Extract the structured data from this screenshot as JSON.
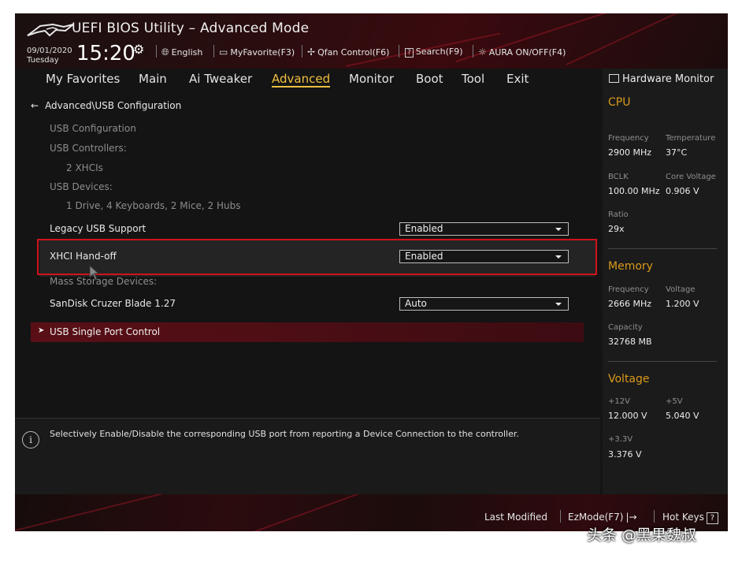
{
  "header": {
    "title": "UEFI BIOS Utility – Advanced Mode",
    "date": "09/01/2020",
    "day": "Tuesday",
    "time": "15:20",
    "tools": [
      {
        "label": "English",
        "icon": "globe-icon"
      },
      {
        "label": "MyFavorite(F3)",
        "icon": "favorites-icon"
      },
      {
        "label": "Qfan Control(F6)",
        "icon": "fan-icon"
      },
      {
        "label": "Search(F9)",
        "icon": "search-help-icon"
      },
      {
        "label": "AURA ON/OFF(F4)",
        "icon": "aura-icon"
      }
    ]
  },
  "nav": {
    "tabs": [
      "My Favorites",
      "Main",
      "Ai Tweaker",
      "Advanced",
      "Monitor",
      "Boot",
      "Tool",
      "Exit"
    ],
    "active": "Advanced"
  },
  "main": {
    "breadcrumb": "Advanced\\USB Configuration",
    "info": {
      "usb_config": "USB Configuration",
      "usb_controllers": "USB Controllers:",
      "controllers_value": "2 XHCIs",
      "usb_devices": "USB Devices:",
      "devices_value": "1 Drive, 4 Keyboards, 2 Mice, 2 Hubs",
      "mass_storage": "Mass Storage Devices:"
    },
    "settings": [
      {
        "label": "Legacy USB Support",
        "value": "Enabled"
      },
      {
        "label": "XHCI Hand-off",
        "value": "Enabled"
      },
      {
        "label": "SanDisk Cruzer Blade 1.27",
        "value": "Auto"
      }
    ],
    "submenu": "USB Single Port Control",
    "help": "Selectively Enable/Disable the corresponding USB port from reporting a Device Connection to the controller."
  },
  "hardware_monitor": {
    "title": "Hardware Monitor",
    "cpu": {
      "heading": "CPU",
      "frequency_label": "Frequency",
      "frequency": "2900 MHz",
      "temperature_label": "Temperature",
      "temperature": "37°C",
      "bclk_label": "BCLK",
      "bclk": "100.00 MHz",
      "core_voltage_label": "Core Voltage",
      "core_voltage": "0.906 V",
      "ratio_label": "Ratio",
      "ratio": "29x"
    },
    "memory": {
      "heading": "Memory",
      "frequency_label": "Frequency",
      "frequency": "2666 MHz",
      "voltage_label": "Voltage",
      "voltage": "1.200 V",
      "capacity_label": "Capacity",
      "capacity": "32768 MB"
    },
    "voltage": {
      "heading": "Voltage",
      "v12_label": "+12V",
      "v12": "12.000 V",
      "v5_label": "+5V",
      "v5": "5.040 V",
      "v33_label": "+3.3V",
      "v33": "3.376 V"
    }
  },
  "footer": {
    "last_modified": "Last Modified",
    "ezmode": "EzMode(F7)",
    "hotkeys": "Hot Keys",
    "hotkeys_key": "?"
  },
  "watermark": "头条 @黑果魏叔",
  "colors": {
    "accent": "#f0c040",
    "highlight_border": "#d0121d",
    "section": "#d99a1c"
  }
}
